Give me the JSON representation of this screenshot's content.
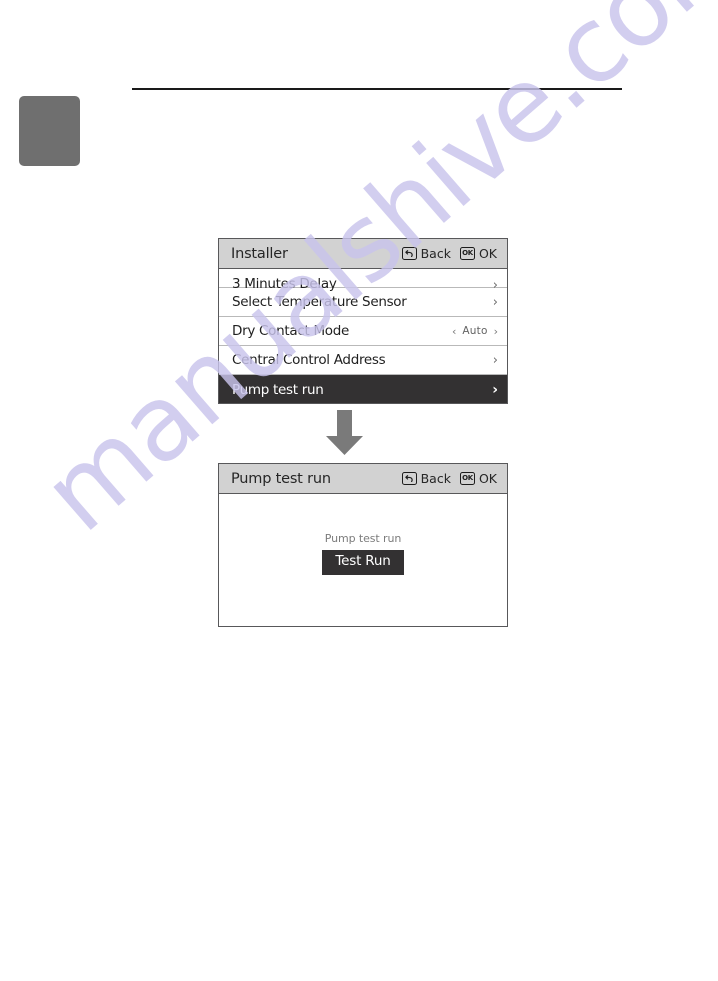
{
  "document": {
    "watermark": "manualshive.com",
    "page_tab_color": "#6f6f6f",
    "rule_color": "#1a1a1a"
  },
  "flow": {
    "arrow_icon": "arrow-down-icon",
    "arrow_color": "#7a7a7a"
  },
  "screen_installer": {
    "title": "Installer",
    "header": {
      "back_icon": "back-arrow-icon",
      "back_label": "Back",
      "ok_icon": "ok-key-icon",
      "ok_key_text": "OK",
      "ok_label": "OK",
      "background": "#d2d2d2"
    },
    "rows": [
      {
        "label": "3 Minutes Delay",
        "value": "",
        "chevron": "›",
        "selected": false,
        "clipped": true
      },
      {
        "label": "Select Temperature Sensor",
        "value": "",
        "chevron": "›",
        "selected": false,
        "clipped": false
      },
      {
        "label": "Dry Contact Mode",
        "value": "Auto",
        "chevron_left": "‹",
        "chevron": "›",
        "selected": false,
        "clipped": false
      },
      {
        "label": "Central Control Address",
        "value": "",
        "chevron": "›",
        "selected": false,
        "clipped": false
      },
      {
        "label": "Pump test run",
        "value": "",
        "chevron": "›",
        "selected": true,
        "clipped": false
      }
    ]
  },
  "screen_pump": {
    "title": "Pump test run",
    "header": {
      "back_icon": "back-arrow-icon",
      "back_label": "Back",
      "ok_icon": "ok-key-icon",
      "ok_key_text": "OK",
      "ok_label": "OK",
      "background": "#d2d2d2"
    },
    "body": {
      "caption": "Pump test run",
      "button_label": "Test Run",
      "button_color": "#333132"
    }
  }
}
